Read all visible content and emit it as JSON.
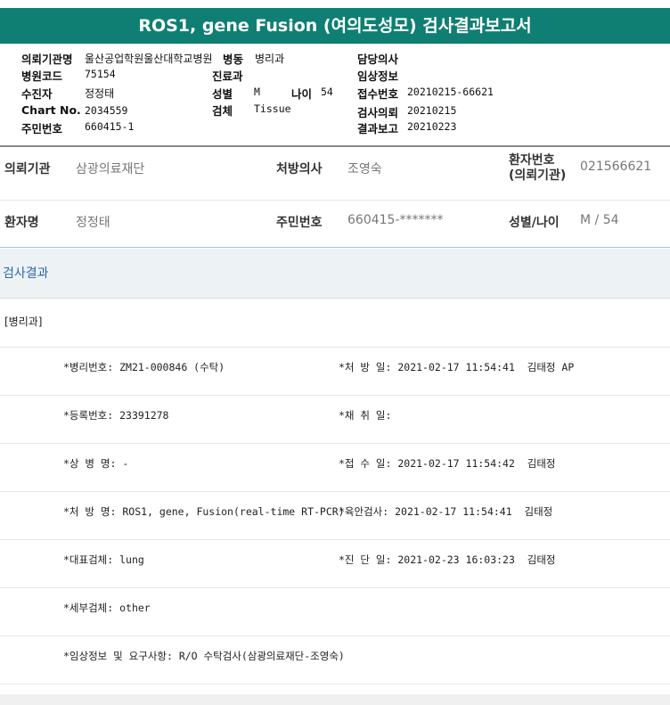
{
  "title": "ROS1, gene Fusion (여의도성모) 검사결과보고서",
  "header": {
    "requesting_org_label": "의뢰기관명",
    "requesting_org_value": "울산공업학원울산대학교병원",
    "ward_label": "병동",
    "ward_value": "병리과",
    "doctor_label": "담당의사",
    "hospital_code_label": "병원코드",
    "hospital_code_value": "75154",
    "dept_label": "진료과",
    "clinical_info_label": "임상정보",
    "receiver_label": "수진자",
    "receiver_value": "정정태",
    "sex_label": "성별",
    "sex_value": "M",
    "age_label": "나이",
    "age_value": "54",
    "receipt_no_label": "접수번호",
    "receipt_no_value": "20210215-66621",
    "chart_no_label": "Chart No.",
    "chart_no_value": "2034559",
    "specimen_label": "검체",
    "specimen_value": "Tissue",
    "test_request_label": "검사의뢰",
    "test_request_value": "20210215",
    "rrn_label": "주민번호",
    "rrn_value": "660415-1",
    "result_report_label": "결과보고",
    "result_report_value": "20210223"
  },
  "info": {
    "org_label": "의뢰기관",
    "org_value": "삼광의료재단",
    "prescriber_label": "처방의사",
    "prescriber_value": "조영숙",
    "patient_no_label_1": "환자번호",
    "patient_no_label_2": "(의뢰기관)",
    "patient_no_value": "021566621",
    "patient_name_label": "환자명",
    "patient_name_value": "정정태",
    "rrn_label": "주민번호",
    "rrn_value": "660415-*******",
    "sex_age_label": "성별/나이",
    "sex_age_value": "M / 54"
  },
  "results": {
    "section_title": "검사결과",
    "dept": "[병리과]",
    "rows": [
      {
        "left": "*병리번호: ZM21-000846 (수탁)",
        "right": "*처 방 일: 2021-02-17 11:54:41  김태정 AP"
      },
      {
        "left": "*등록번호: 23391278",
        "right": "*채 취 일:"
      },
      {
        "left": "*상 병 명: -",
        "right": "*접 수 일: 2021-02-17 11:54:42  김태정"
      },
      {
        "left": "*처 방 명: ROS1, gene, Fusion(real-time RT-PCR)",
        "right": "*육안검사: 2021-02-17 11:54:41  김태정"
      },
      {
        "left": "*대표검체: lung",
        "right": "*진 단 일: 2021-02-23 16:03:23  김태정"
      },
      {
        "left": "*세부검체: other",
        "right": ""
      },
      {
        "left": "*임상정보 및 요구사항: R/O 수탁검사(삼광의료재단-조영숙)",
        "right": ""
      }
    ]
  }
}
